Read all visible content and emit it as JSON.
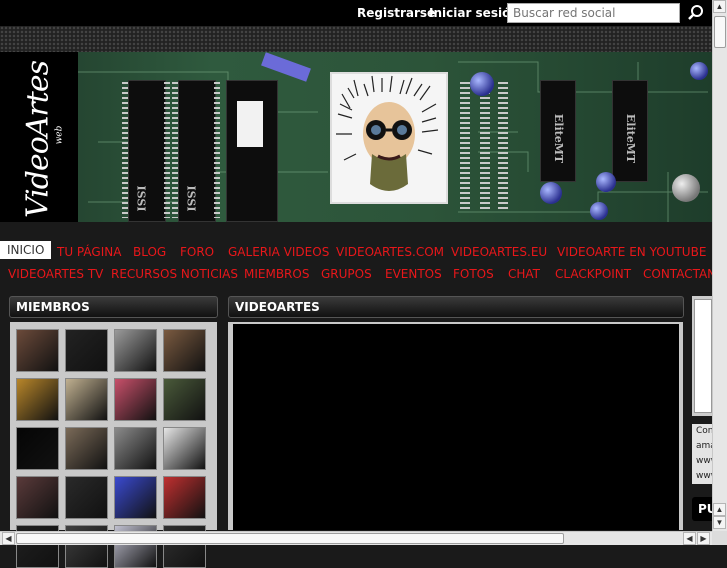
{
  "header": {
    "register_label": "Registrarse",
    "login_label": "Iniciar sesión",
    "search_placeholder": "Buscar red social"
  },
  "banner": {
    "logo_text": "VideoArtes",
    "logo_subtext": "web",
    "chip_labels": [
      "ISSI",
      "ISSI",
      "EliteMT",
      "EliteMT"
    ]
  },
  "nav": {
    "row1": [
      "INICIO",
      "TU PÁGINA",
      "BLOG",
      "FORO",
      "GALERIA VIDEOS",
      "VIDEOARTES.COM",
      "VIDEOARTES.EU",
      "VIDEOARTE EN YOUTUBE"
    ],
    "row2": [
      "VIDEOARTES TV",
      "RECURSOS NOTICIAS",
      "MIEMBROS",
      "GRUPOS",
      "EVENTOS",
      "FOTOS",
      "CHAT",
      "CLACKPOINT",
      "CONTACTANO"
    ]
  },
  "members": {
    "title": "MIEMBROS",
    "thumb_colors": [
      "#6b4a3a",
      "#222222",
      "#9a9a9a",
      "#7a5a40",
      "#b8862a",
      "#c0b090",
      "#c8506a",
      "#4a5a3a",
      "#050505",
      "#7a6a58",
      "#8a8a8a",
      "#e6e6e6",
      "#5a3a3a",
      "#2a2a2a",
      "#3a4ad0",
      "#c03030",
      "#202020",
      "#404040",
      "#c0c0d0",
      "#303030"
    ]
  },
  "videos": {
    "title": "VIDEOARTES"
  },
  "sidebar": {
    "text_lines": [
      "Con",
      "ama",
      "www",
      "www"
    ],
    "head": "PU"
  },
  "colors": {
    "nav_link": "#e8171a",
    "panel_bg": "#c9c9c9"
  }
}
